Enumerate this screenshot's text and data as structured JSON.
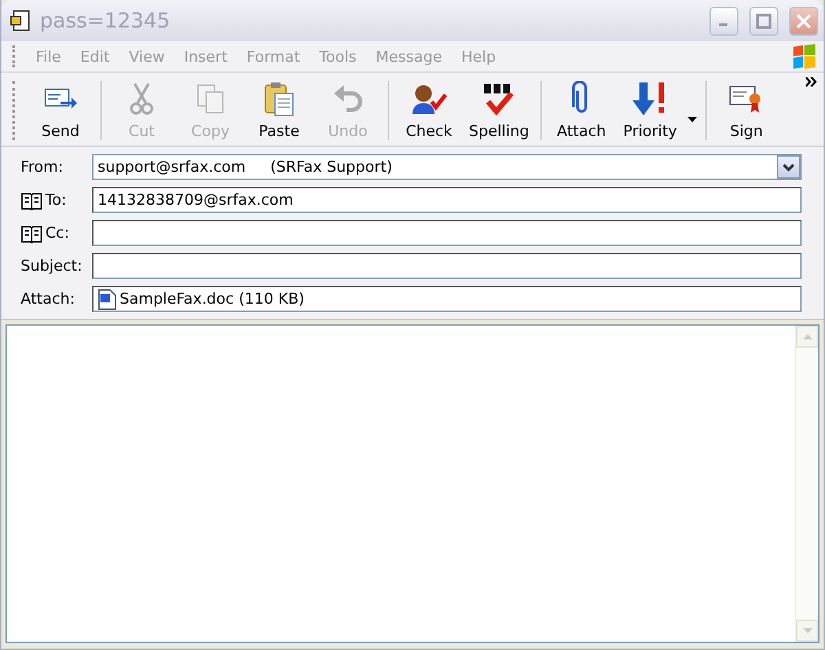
{
  "window": {
    "title": "pass=12345",
    "active": false
  },
  "menu": [
    "File",
    "Edit",
    "View",
    "Insert",
    "Format",
    "Tools",
    "Message",
    "Help"
  ],
  "toolbar": [
    {
      "kind": "button",
      "label": "Send",
      "disabled": false
    },
    {
      "kind": "separator"
    },
    {
      "kind": "button",
      "label": "Cut",
      "disabled": true
    },
    {
      "kind": "button",
      "label": "Copy",
      "disabled": true
    },
    {
      "kind": "button",
      "label": "Paste",
      "disabled": false
    },
    {
      "kind": "button",
      "label": "Undo",
      "disabled": true
    },
    {
      "kind": "separator"
    },
    {
      "kind": "button",
      "label": "Check",
      "disabled": false
    },
    {
      "kind": "button",
      "label": "Spelling",
      "disabled": false
    },
    {
      "kind": "separator"
    },
    {
      "kind": "button",
      "label": "Attach",
      "disabled": false
    },
    {
      "kind": "dropdown",
      "label": "Priority",
      "disabled": false
    },
    {
      "kind": "separator"
    },
    {
      "kind": "button",
      "label": "Sign",
      "disabled": false
    }
  ],
  "fields": [
    {
      "kind": "select",
      "label": "From:",
      "address_book": false,
      "value": "support@srfax.com",
      "display_name": "(SRFax Support)"
    },
    {
      "kind": "text",
      "label": "To:",
      "address_book": true,
      "value": "14132838709@srfax.com"
    },
    {
      "kind": "text",
      "label": "Cc:",
      "address_book": true
    },
    {
      "kind": "text",
      "label": "Subject:",
      "address_book": false
    },
    {
      "kind": "attachment",
      "label": "Attach:",
      "address_book": false,
      "value": "SampleFax.doc (110 KB)"
    }
  ]
}
